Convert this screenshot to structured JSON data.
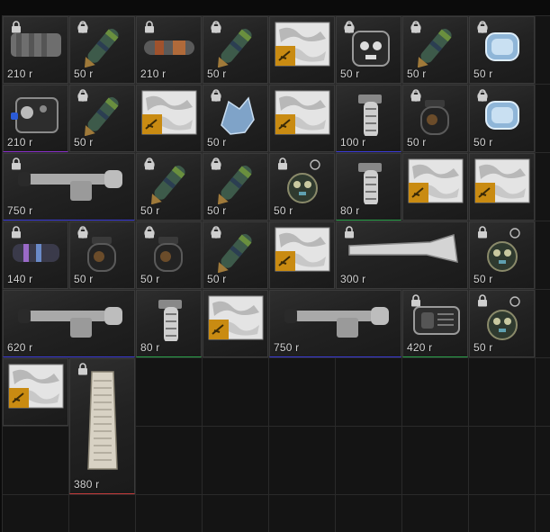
{
  "rarity_colors": {
    "blue": "#3b3bd8",
    "green": "#2aa24a",
    "red": "#c43a3a",
    "purple": "#8a2fc9"
  },
  "items": [
    {
      "name": "grip-cover-item",
      "icon": "rail-cover-icon",
      "price": "210 r",
      "locked": true,
      "col": 0,
      "row": 0,
      "w": 1,
      "h": 1,
      "rarity": ""
    },
    {
      "name": "charm-camo-green-item",
      "icon": "cartridge-charm-icon",
      "price": "50 r",
      "locked": true,
      "col": 1,
      "row": 0,
      "w": 1,
      "h": 1,
      "rarity": ""
    },
    {
      "name": "silencer-rust-item",
      "icon": "suppressor-icon",
      "price": "210 r",
      "locked": true,
      "col": 2,
      "row": 0,
      "w": 1,
      "h": 1,
      "rarity": ""
    },
    {
      "name": "charm-camo-yellow-item",
      "icon": "cartridge-charm-icon",
      "price": "50 r",
      "locked": true,
      "col": 3,
      "row": 0,
      "w": 1,
      "h": 1,
      "rarity": ""
    },
    {
      "name": "skin-snow-camo-item",
      "icon": "camo-skin-icon",
      "price": "",
      "locked": false,
      "col": 4,
      "row": 0,
      "w": 1,
      "h": 1,
      "rarity": ""
    },
    {
      "name": "charm-skull-item",
      "icon": "skull-charm-icon",
      "price": "50 r",
      "locked": true,
      "col": 5,
      "row": 0,
      "w": 1,
      "h": 1,
      "rarity": ""
    },
    {
      "name": "charm-bullet-item",
      "icon": "cartridge-charm-icon",
      "price": "50 r",
      "locked": true,
      "col": 6,
      "row": 0,
      "w": 1,
      "h": 1,
      "rarity": ""
    },
    {
      "name": "charm-ice-item",
      "icon": "ice-charm-icon",
      "price": "50 r",
      "locked": true,
      "col": 7,
      "row": 0,
      "w": 1,
      "h": 1,
      "rarity": ""
    },
    {
      "name": "tactical-device-item",
      "icon": "laser-module-icon",
      "price": "210 r",
      "locked": false,
      "col": 0,
      "row": 1,
      "w": 1,
      "h": 1,
      "rarity": "purple"
    },
    {
      "name": "charm-camo-green-2-item",
      "icon": "cartridge-charm-icon",
      "price": "50 r",
      "locked": true,
      "col": 1,
      "row": 1,
      "w": 1,
      "h": 1,
      "rarity": ""
    },
    {
      "name": "skin-white-camo-item",
      "icon": "camo-skin-icon",
      "price": "",
      "locked": false,
      "col": 2,
      "row": 1,
      "w": 1,
      "h": 1,
      "rarity": ""
    },
    {
      "name": "charm-crystal-item",
      "icon": "crystal-charm-icon",
      "price": "50 r",
      "locked": true,
      "col": 3,
      "row": 1,
      "w": 1,
      "h": 1,
      "rarity": ""
    },
    {
      "name": "skin-grey-camo-item",
      "icon": "camo-skin-icon",
      "price": "",
      "locked": false,
      "col": 4,
      "row": 1,
      "w": 1,
      "h": 1,
      "rarity": ""
    },
    {
      "name": "foregrip-white-item",
      "icon": "vertical-grip-icon",
      "price": "100 r",
      "locked": false,
      "col": 5,
      "row": 1,
      "w": 1,
      "h": 1,
      "rarity": "blue"
    },
    {
      "name": "charm-grenade-item",
      "icon": "grenade-charm-icon",
      "price": "50 r",
      "locked": true,
      "col": 6,
      "row": 1,
      "w": 1,
      "h": 1,
      "rarity": ""
    },
    {
      "name": "charm-ice-2-item",
      "icon": "ice-charm-icon",
      "price": "50 r",
      "locked": true,
      "col": 7,
      "row": 1,
      "w": 1,
      "h": 1,
      "rarity": ""
    },
    {
      "name": "scope-pso-item",
      "icon": "rifle-scope-icon",
      "price": "750 r",
      "locked": true,
      "col": 0,
      "row": 2,
      "w": 2,
      "h": 1,
      "rarity": "blue"
    },
    {
      "name": "charm-camo-3-item",
      "icon": "cartridge-charm-icon",
      "price": "50 r",
      "locked": true,
      "col": 2,
      "row": 2,
      "w": 1,
      "h": 1,
      "rarity": ""
    },
    {
      "name": "charm-red-item",
      "icon": "cartridge-charm-icon",
      "price": "50 r",
      "locked": true,
      "col": 3,
      "row": 2,
      "w": 1,
      "h": 1,
      "rarity": ""
    },
    {
      "name": "charm-bomb-item",
      "icon": "bomb-charm-icon",
      "price": "50 r",
      "locked": true,
      "col": 4,
      "row": 2,
      "w": 1,
      "h": 1,
      "rarity": ""
    },
    {
      "name": "foregrip-short-item",
      "icon": "vertical-grip-icon",
      "price": "80 r",
      "locked": false,
      "col": 5,
      "row": 2,
      "w": 1,
      "h": 1,
      "rarity": "green"
    },
    {
      "name": "skin-arctic-camo-item",
      "icon": "camo-skin-icon",
      "price": "",
      "locked": false,
      "col": 6,
      "row": 2,
      "w": 1,
      "h": 1,
      "rarity": ""
    },
    {
      "name": "skin-digital-camo-item",
      "icon": "camo-skin-icon",
      "price": "",
      "locked": false,
      "col": 7,
      "row": 2,
      "w": 1,
      "h": 1,
      "rarity": ""
    },
    {
      "name": "muzzle-purple-item",
      "icon": "muzzle-brake-icon",
      "price": "140 r",
      "locked": true,
      "col": 0,
      "row": 3,
      "w": 1,
      "h": 1,
      "rarity": ""
    },
    {
      "name": "charm-grenade-2-item",
      "icon": "grenade-charm-icon",
      "price": "50 r",
      "locked": true,
      "col": 1,
      "row": 3,
      "w": 1,
      "h": 1,
      "rarity": ""
    },
    {
      "name": "charm-grenade-3-item",
      "icon": "grenade-charm-icon",
      "price": "50 r",
      "locked": true,
      "col": 2,
      "row": 3,
      "w": 1,
      "h": 1,
      "rarity": ""
    },
    {
      "name": "charm-bullet-2-item",
      "icon": "cartridge-charm-icon",
      "price": "50 r",
      "locked": true,
      "col": 3,
      "row": 3,
      "w": 1,
      "h": 1,
      "rarity": ""
    },
    {
      "name": "skin-grey-camo-2-item",
      "icon": "camo-skin-icon",
      "price": "",
      "locked": false,
      "col": 4,
      "row": 3,
      "w": 1,
      "h": 1,
      "rarity": ""
    },
    {
      "name": "stock-white-item",
      "icon": "rifle-stock-icon",
      "price": "300 r",
      "locked": true,
      "col": 5,
      "row": 3,
      "w": 2,
      "h": 1,
      "rarity": ""
    },
    {
      "name": "charm-bomb-2-item",
      "icon": "bomb-charm-icon",
      "price": "50 r",
      "locked": true,
      "col": 7,
      "row": 3,
      "w": 1,
      "h": 1,
      "rarity": ""
    },
    {
      "name": "scope-pso-2-item",
      "icon": "rifle-scope-icon",
      "price": "620 r",
      "locked": false,
      "col": 0,
      "row": 4,
      "w": 2,
      "h": 1,
      "rarity": "blue"
    },
    {
      "name": "foregrip-short-2-item",
      "icon": "vertical-grip-icon",
      "price": "80 r",
      "locked": false,
      "col": 2,
      "row": 4,
      "w": 1,
      "h": 1,
      "rarity": "green"
    },
    {
      "name": "skin-white-camo-2-item",
      "icon": "camo-skin-icon",
      "price": "",
      "locked": false,
      "col": 3,
      "row": 4,
      "w": 1,
      "h": 1,
      "rarity": ""
    },
    {
      "name": "scope-pso-3-item",
      "icon": "rifle-scope-icon",
      "price": "750 r",
      "locked": false,
      "col": 4,
      "row": 4,
      "w": 2,
      "h": 1,
      "rarity": "blue"
    },
    {
      "name": "sight-holo-item",
      "icon": "holographic-sight-icon",
      "price": "420 r",
      "locked": true,
      "col": 6,
      "row": 4,
      "w": 1,
      "h": 1,
      "rarity": "green"
    },
    {
      "name": "charm-bomb-3-item",
      "icon": "bomb-charm-icon",
      "price": "50 r",
      "locked": true,
      "col": 7,
      "row": 4,
      "w": 1,
      "h": 1,
      "rarity": ""
    },
    {
      "name": "skin-winter-camo-item",
      "icon": "camo-skin-icon",
      "price": "",
      "locked": false,
      "col": 0,
      "row": 5,
      "w": 1,
      "h": 1,
      "rarity": ""
    },
    {
      "name": "magazine-white-item",
      "icon": "magazine-icon",
      "price": "380 r",
      "locked": true,
      "col": 1,
      "row": 5,
      "w": 1,
      "h": 2,
      "rarity": "red"
    }
  ]
}
